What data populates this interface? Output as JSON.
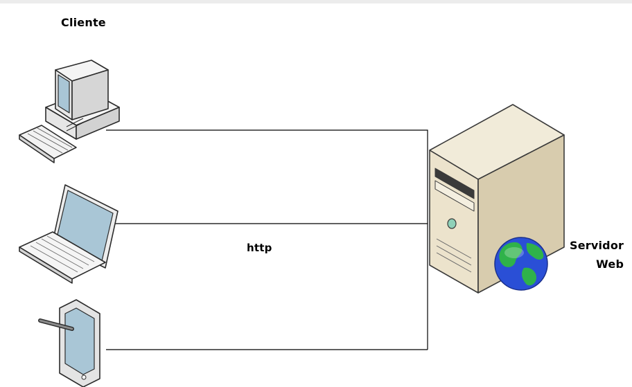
{
  "labels": {
    "client": "Cliente",
    "protocol": "http",
    "server_line1": "Servidor",
    "server_line2": "Web"
  },
  "nodes": [
    {
      "id": "desktop",
      "icon": "desktop-computer-icon"
    },
    {
      "id": "laptop",
      "icon": "laptop-icon"
    },
    {
      "id": "tablet",
      "icon": "tablet-with-stylus-icon"
    },
    {
      "id": "server",
      "icon": "web-server-tower-icon"
    },
    {
      "id": "globe",
      "icon": "globe-icon"
    }
  ],
  "colors": {
    "line": "#000000",
    "device_body": "#f2f2f2",
    "device_outline": "#2b2b2b",
    "screen": "#a9c6d6",
    "server_body": "#ece3cc",
    "server_side": "#d8ccae",
    "globe_ocean": "#2a4fd6",
    "globe_land": "#2fb24a"
  }
}
